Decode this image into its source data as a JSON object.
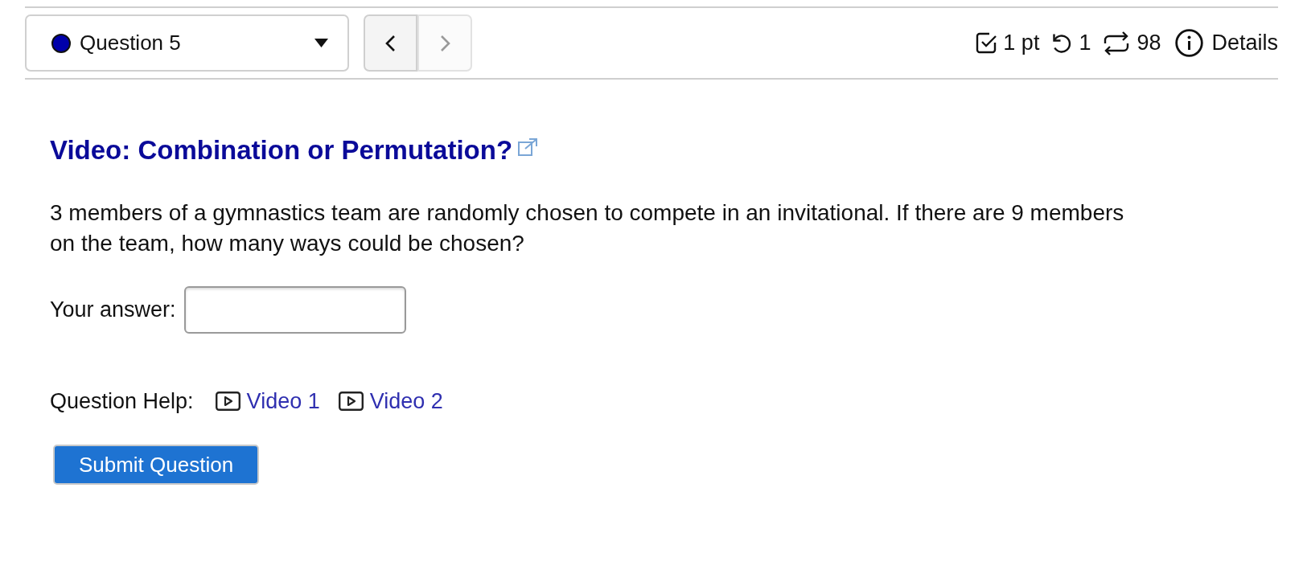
{
  "question_nav": {
    "question_select": {
      "label": "Question 5"
    },
    "prev_button": {
      "disabled": false
    },
    "next_button": {
      "disabled": true
    }
  },
  "stats": [
    {
      "kind": "points",
      "text": "1 pt"
    },
    {
      "kind": "tries",
      "text": "1"
    },
    {
      "kind": "versions",
      "text": "98"
    },
    {
      "kind": "details",
      "text": "Details"
    }
  ],
  "question": {
    "title": "Video: Combination or Permutation?",
    "text": "3 members of a gymnastics team are randomly chosen to compete in an invitational. If there are 9 members on the team, how many ways could be chosen?",
    "answer_label": "Your answer:"
  },
  "help": {
    "label": "Question Help:",
    "links": [
      "Video 1",
      "Video 2"
    ]
  },
  "submit_button": {
    "label": "Submit Question"
  }
}
